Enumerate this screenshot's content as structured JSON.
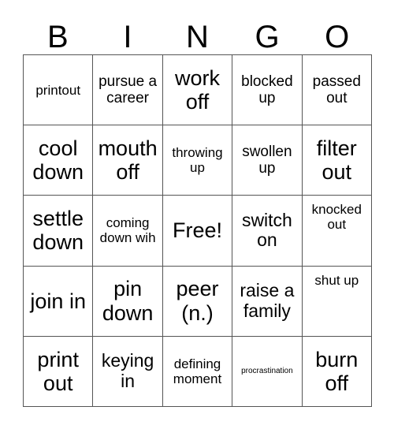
{
  "card": {
    "type": "bingo-card",
    "columns": 5,
    "rows": 5,
    "headers": [
      {
        "letter": "B"
      },
      {
        "letter": "I"
      },
      {
        "letter": "N"
      },
      {
        "letter": "G"
      },
      {
        "letter": "O"
      }
    ],
    "cells": [
      {
        "text": "printout",
        "size": "md",
        "align": "center"
      },
      {
        "text": "pursue a career",
        "size": "lg",
        "align": "center"
      },
      {
        "text": "work off",
        "size": "xxl",
        "align": "center"
      },
      {
        "text": "blocked up",
        "size": "lg",
        "align": "center"
      },
      {
        "text": "passed out",
        "size": "lg",
        "align": "center"
      },
      {
        "text": "cool down",
        "size": "xxl",
        "align": "center"
      },
      {
        "text": "mouth off",
        "size": "xxl",
        "align": "center"
      },
      {
        "text": "throwing up",
        "size": "md",
        "align": "center"
      },
      {
        "text": "swollen up",
        "size": "lg",
        "align": "center"
      },
      {
        "text": "filter out",
        "size": "xxl",
        "align": "center"
      },
      {
        "text": "settle down",
        "size": "xxl",
        "align": "center"
      },
      {
        "text": "coming down wih",
        "size": "md",
        "align": "center"
      },
      {
        "text": "Free!",
        "size": "xxl",
        "align": "center"
      },
      {
        "text": "switch on",
        "size": "xl",
        "align": "center"
      },
      {
        "text": "knocked out",
        "size": "md",
        "align": "top"
      },
      {
        "text": "join in",
        "size": "xxl",
        "align": "center"
      },
      {
        "text": "pin down",
        "size": "xxl",
        "align": "center"
      },
      {
        "text": "peer (n.)",
        "size": "xxl",
        "align": "center"
      },
      {
        "text": "raise a family",
        "size": "xl",
        "align": "center"
      },
      {
        "text": "shut up",
        "size": "md",
        "align": "top"
      },
      {
        "text": "print out",
        "size": "xxl",
        "align": "center"
      },
      {
        "text": "keying in",
        "size": "xl",
        "align": "center"
      },
      {
        "text": "defining moment",
        "size": "md",
        "align": "center"
      },
      {
        "text": "procrastination",
        "size": "xs",
        "align": "center"
      },
      {
        "text": "burn off",
        "size": "xxl",
        "align": "center"
      }
    ],
    "colors": {
      "background": "#ffffff",
      "text": "#000000",
      "grid_line": "#555555"
    }
  }
}
